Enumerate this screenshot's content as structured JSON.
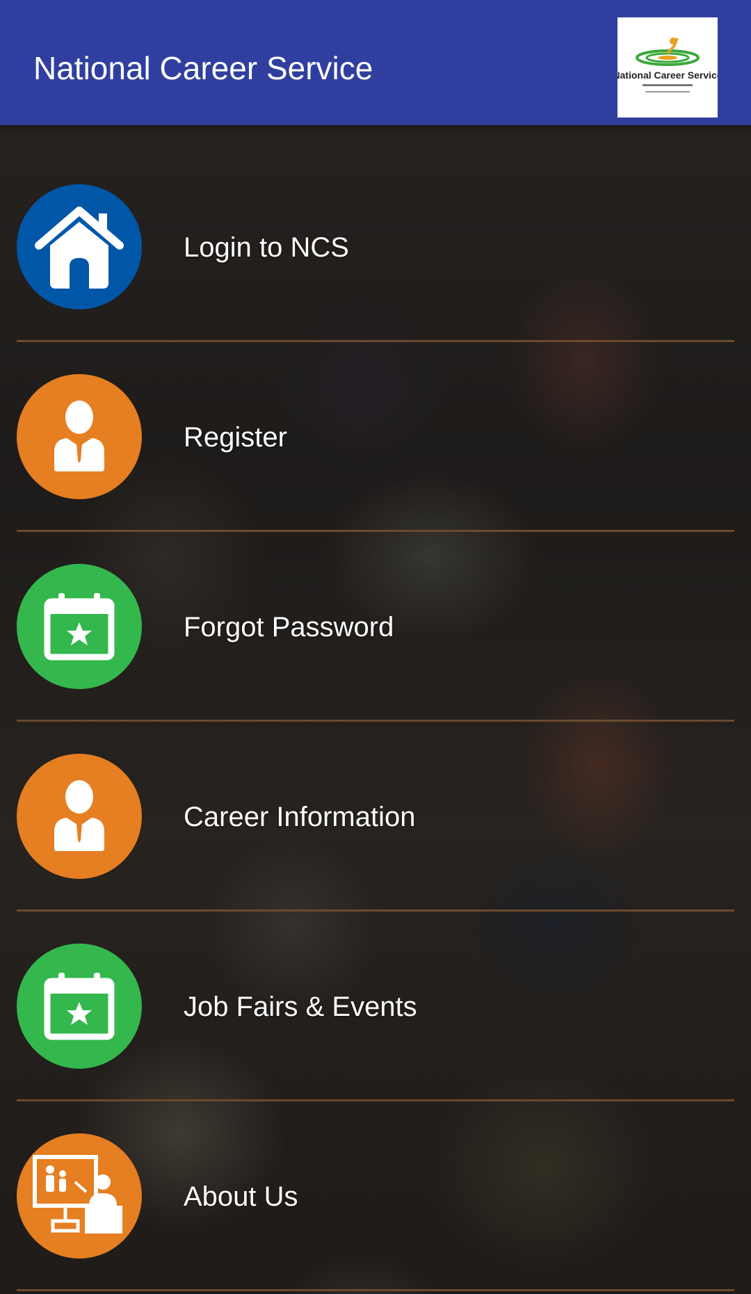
{
  "appbar": {
    "title": "National Career Service",
    "logo_text": "National Career Service",
    "color": "#303f9f"
  },
  "menu": {
    "items": [
      {
        "label": "Login to NCS",
        "icon": "home-icon",
        "color": "#0057a8"
      },
      {
        "label": "Register",
        "icon": "user-icon",
        "color": "#e67e22"
      },
      {
        "label": "Forgot Password",
        "icon": "calendar-star-icon",
        "color": "#34b84d"
      },
      {
        "label": "Career Information",
        "icon": "user-icon",
        "color": "#e67e22"
      },
      {
        "label": "Job Fairs & Events",
        "icon": "calendar-star-icon",
        "color": "#34b84d"
      },
      {
        "label": "About Us",
        "icon": "presentation-icon",
        "color": "#e67e22"
      }
    ]
  },
  "colors": {
    "divider": "#6b4a2e"
  }
}
